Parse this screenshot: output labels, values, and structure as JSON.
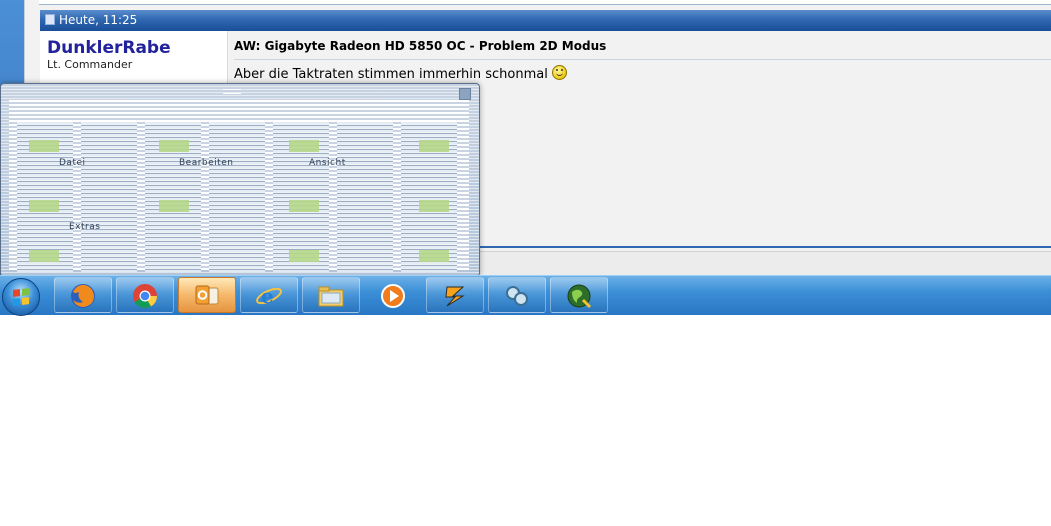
{
  "post": {
    "date": "Heute, 11:25",
    "username": "DunklerRabe",
    "user_title": "Lt. Commander",
    "title": "AW: Gigabyte Radeon HD 5850 OC - Problem 2D Modus",
    "text": "Aber die Taktraten stimmen immerhin schonmal"
  },
  "thumbnail": {
    "labels": [
      "Datei",
      "Bearbeiten",
      "Ansicht",
      "Extras"
    ]
  },
  "taskbar": {
    "buttons": [
      {
        "name": "firefox",
        "icon": "firefox-icon"
      },
      {
        "name": "chrome",
        "icon": "chrome-icon"
      },
      {
        "name": "outlook",
        "icon": "outlook-icon",
        "active": true
      },
      {
        "name": "internet-explorer",
        "icon": "ie-icon"
      },
      {
        "name": "explorer",
        "icon": "folder-icon"
      },
      {
        "name": "media-player",
        "icon": "media-player-icon"
      },
      {
        "name": "winamp",
        "icon": "winamp-icon"
      },
      {
        "name": "app",
        "icon": "link-icon"
      },
      {
        "name": "app2",
        "icon": "globe-icon"
      }
    ]
  },
  "colors": {
    "header": "#2f67b1",
    "username": "#22229c",
    "taskbar": "#3c8fd6"
  }
}
